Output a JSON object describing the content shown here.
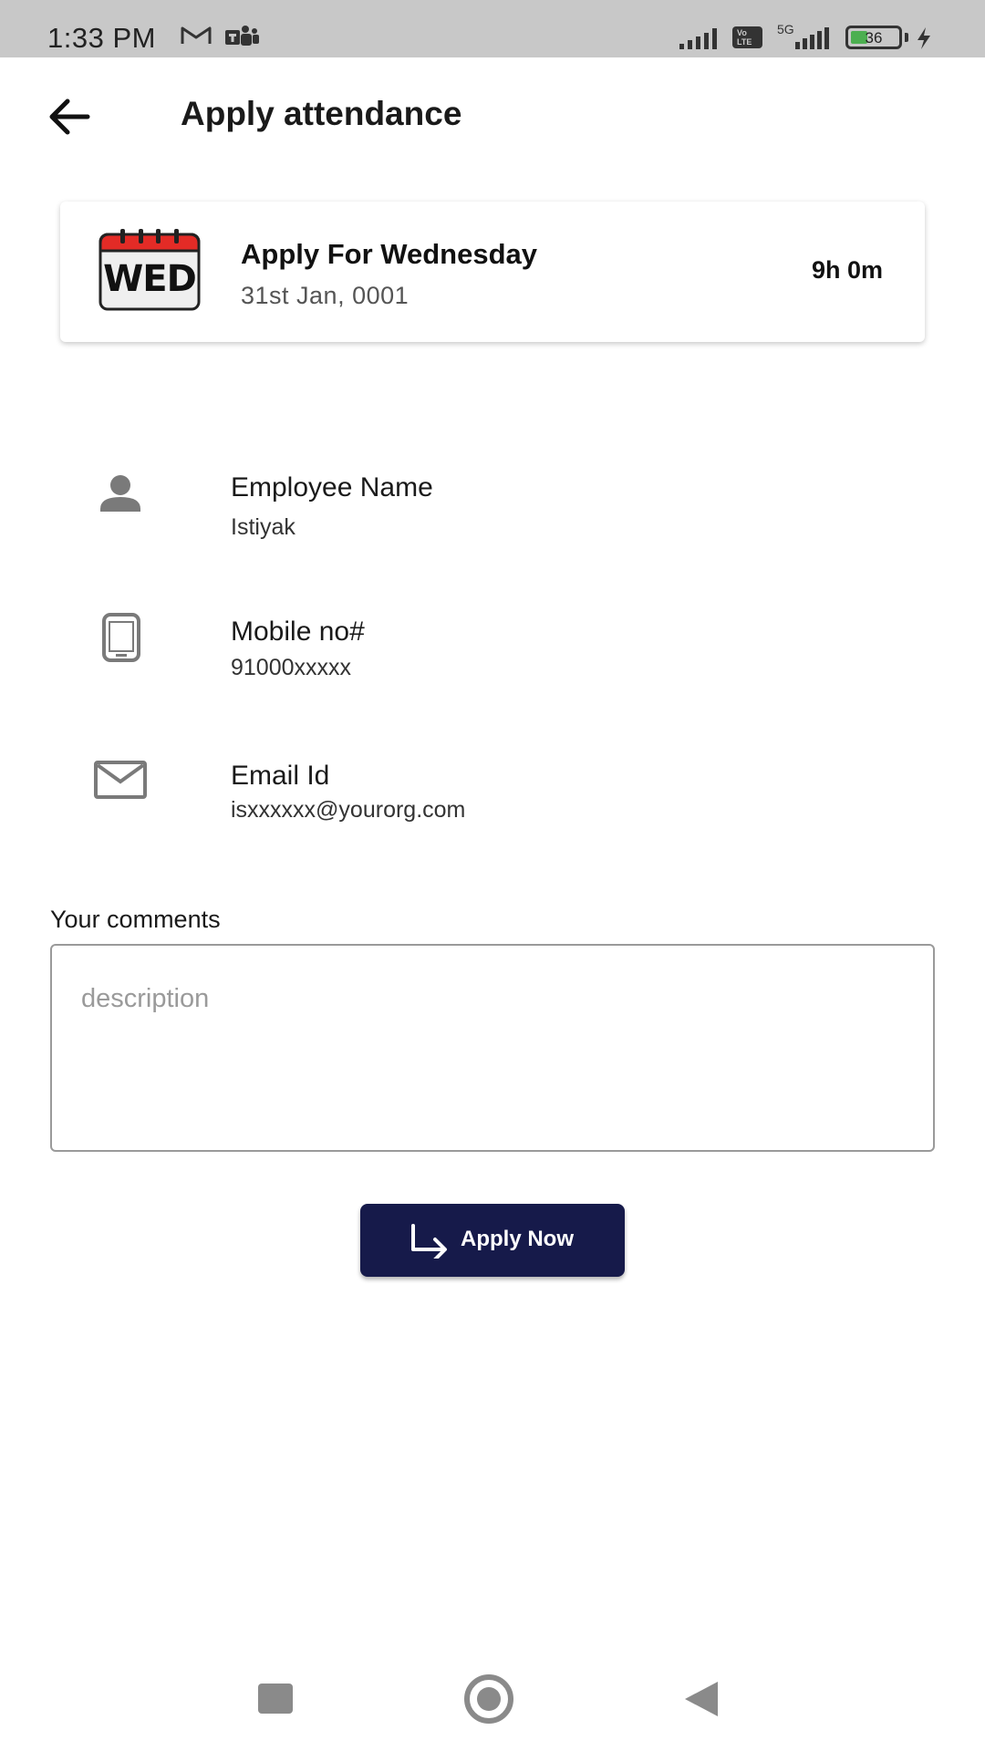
{
  "status_bar": {
    "time": "1:33 PM",
    "battery_level": "36",
    "network": "5G",
    "battery_fraction": 0.36
  },
  "header": {
    "title": "Apply attendance",
    "back_icon": "arrow-left-icon"
  },
  "day_card": {
    "icon_label": "WED",
    "title": "Apply For Wednesday",
    "date": "31st Jan, 0001",
    "hours": "9h 0m"
  },
  "info": {
    "employee": {
      "label": "Employee Name",
      "value": "Istiyak",
      "icon": "person-icon"
    },
    "mobile": {
      "label": "Mobile no#",
      "value": "91000xxxxx",
      "icon": "phone-icon"
    },
    "email": {
      "label": "Email Id",
      "value": "isxxxxxx@yourorg.com",
      "icon": "mail-icon"
    }
  },
  "comments": {
    "label": "Your comments",
    "placeholder": "description",
    "value": ""
  },
  "apply_button": {
    "label": "Apply Now",
    "icon": "arrow-turn-right-icon"
  },
  "colors": {
    "button_bg": "#161a4a",
    "calendar_red": "#e32b26",
    "status_bar_bg": "#c8c8c8",
    "battery_green": "#4caf50"
  },
  "nav_bar": {
    "recents_icon": "square-icon",
    "home_icon": "circle-icon",
    "back_icon": "triangle-back-icon"
  }
}
